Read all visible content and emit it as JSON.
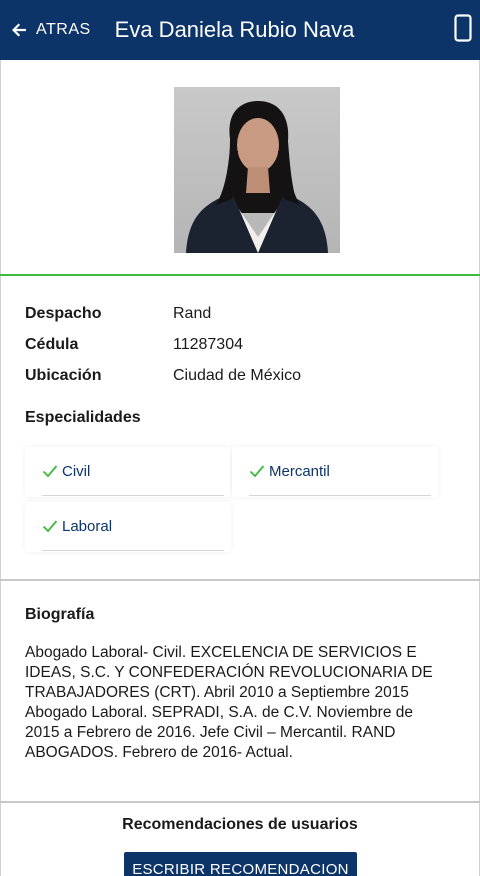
{
  "header": {
    "back_label": "ATRAS",
    "title": "Eva Daniela Rubio Nava",
    "background": "#0d3468"
  },
  "profile": {
    "photo_alt": "Eva Daniela Rubio Nava",
    "fields": [
      {
        "label": "Despacho",
        "value": "Rand"
      },
      {
        "label": "Cédula",
        "value": "11287304"
      },
      {
        "label": "Ubicación",
        "value": "Ciudad de México"
      }
    ]
  },
  "specialties": {
    "title": "Especialidades",
    "items": [
      "Civil",
      "Mercantil",
      "Laboral"
    ],
    "check_color": "#3dbb3d"
  },
  "biography": {
    "title": "Biografía",
    "text": "Abogado Laboral- Civil. EXCELENCIA DE SERVICIOS E IDEAS, S.C. Y CONFEDERACIÓN REVOLUCIONARIA DE TRABAJADORES (CRT). Abril 2010 a Septiembre 2015 Abogado Laboral. SEPRADI, S.A. de C.V. Noviembre de 2015 a Febrero de 2016. Jefe Civil – Mercantil. RAND ABOGADOS. Febrero de 2016- Actual."
  },
  "recommendations": {
    "title": "Recomendaciones de usuarios",
    "button_label": "ESCRIBIR RECOMENDACION"
  },
  "icons": {
    "back": "arrow-left-icon",
    "device": "smartphone-icon",
    "check": "check-icon"
  }
}
